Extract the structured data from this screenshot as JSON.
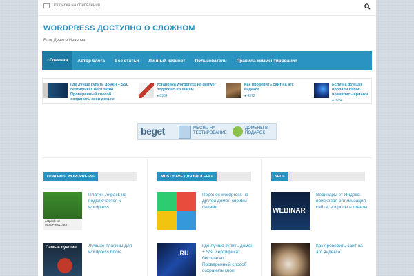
{
  "topbar": {
    "subscribe_label": "Подписка на обновления"
  },
  "site": {
    "title": "WORDPRESS ДОСТУПНО О СЛОЖНОМ",
    "tagline": "Блог Дениса Иванова"
  },
  "nav": {
    "items": [
      {
        "label": "Главная"
      },
      {
        "label": "Автор блога"
      },
      {
        "label": "Все статьи"
      },
      {
        "label": "Личный кабинет"
      },
      {
        "label": "Пользователи"
      },
      {
        "label": "Правила комментирования"
      }
    ]
  },
  "ticker": [
    {
      "title": "Где лучше купить домен + SSL сертификат бесплатно. Проверенный способ сохранить свои деньги",
      "views": ""
    },
    {
      "title": "Установка wordpress на denwer подробно по шагам",
      "views": "8984"
    },
    {
      "title": "Как проверить сайт на агс яндекса",
      "views": "4372"
    },
    {
      "title": "Если на флешке пропали папок появились ярлыки",
      "views": "3234"
    }
  ],
  "banner": {
    "logo": "beget",
    "text1_line1": "МЕСЯЦ НА",
    "text1_line2": "ТЕСТИРОВАНИЕ",
    "text2_line1": "ДОМЕНЫ В",
    "text2_line2": "ПОДАРОК"
  },
  "columns": [
    {
      "heading": "ПЛАГИНЫ WORDPRESS»",
      "posts": [
        {
          "title": "Плагин Jetpack не подключается к wordpress",
          "thumb_caption": "Jetpack for WordPress.com"
        },
        {
          "title": "Лучшие плагины для wordpress блога",
          "thumb_caption": "Самые лучшие"
        }
      ]
    },
    {
      "heading": "MUST HAVE ДЛЯ БЛОГЕРА»",
      "posts": [
        {
          "title": "Перенос wordpress на другой домен своими силами",
          "thumb_caption": ""
        },
        {
          "title": "Где лучше купить домен + SSL сертификат бесплатно. Проверенный способ сохранить свои",
          "thumb_caption": ".RU"
        }
      ]
    },
    {
      "heading": "SEO»",
      "posts": [
        {
          "title": "Вебинары от Яндекс: поисковая оптимизация сайта, вопросы и ответы",
          "thumb_caption": "WEBINAR"
        },
        {
          "title": "Как проверить сайт на агс яндекса",
          "thumb_caption": ""
        }
      ]
    }
  ],
  "colors": {
    "accent": "#2a93bf",
    "title": "#2b8cb8",
    "nav_active": "#1e7aa3"
  }
}
